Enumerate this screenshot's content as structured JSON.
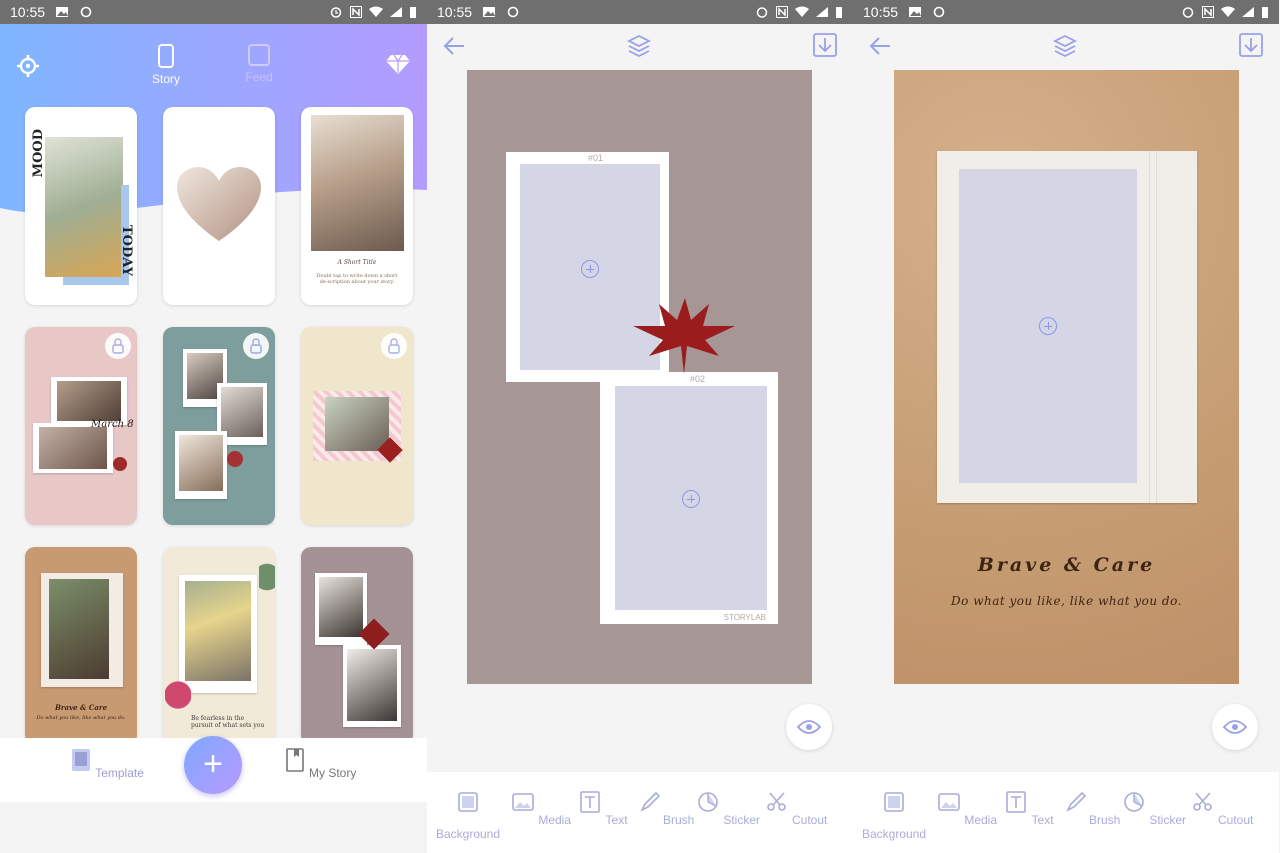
{
  "status_bar": {
    "time": "10:55"
  },
  "home": {
    "modes": [
      {
        "label": "Story"
      },
      {
        "label": "Feed"
      }
    ],
    "cards": [
      {
        "text_a": "MOOD",
        "text_b": "TODAY"
      },
      {},
      {
        "title": "A Short Title",
        "body": "Doubl tap to write down a short de-scription about your story."
      },
      {
        "locked": true,
        "text": "March 8"
      },
      {
        "locked": true
      },
      {
        "locked": true
      },
      {
        "title": "Brave & Care",
        "body": "Do what you like, like what you do."
      },
      {
        "body": "Be fearless in the pursuit of what sets you"
      },
      {}
    ],
    "bottom_nav": {
      "template_label": "Template",
      "my_story_label": "My Story"
    },
    "fab_label": "+",
    "colors": {
      "gradient_start": "#7fb6ff",
      "gradient_end": "#b39cff",
      "accent": "#9aa0d6"
    }
  },
  "editor1": {
    "slot_labels": [
      "#01",
      "#02"
    ],
    "watermark": "STORYLAB",
    "background_color": "#a69695"
  },
  "editor2": {
    "title": "Brave & Care",
    "subtitle": "Do what you like, like what you do.",
    "background_color": "#c8a078"
  },
  "toolbar": {
    "items": [
      {
        "label": "Background",
        "icon": "background-icon"
      },
      {
        "label": "Media",
        "icon": "media-icon"
      },
      {
        "label": "Text",
        "icon": "text-icon"
      },
      {
        "label": "Brush",
        "icon": "brush-icon"
      },
      {
        "label": "Sticker",
        "icon": "sticker-icon"
      },
      {
        "label": "Cutout",
        "icon": "cutout-icon"
      }
    ]
  }
}
